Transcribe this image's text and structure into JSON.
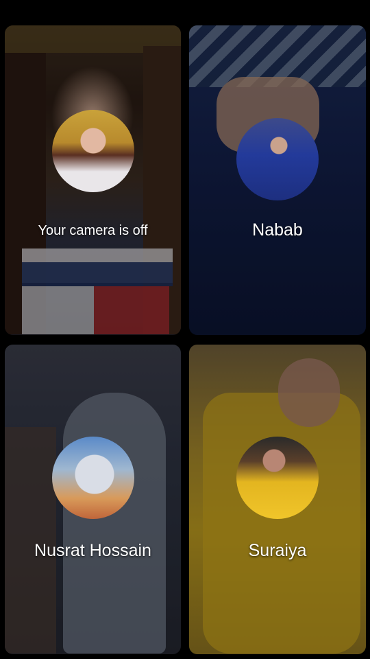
{
  "participants": [
    {
      "label": "Your camera is off",
      "avatar_icon": "user-avatar-icon",
      "tile_tone": "#3b2c22"
    },
    {
      "label": "Nabab",
      "avatar_icon": "user-avatar-icon",
      "tile_tone": "#13204a"
    },
    {
      "label": "Nusrat Hossain",
      "avatar_icon": "user-avatar-icon",
      "tile_tone": "#2e3342"
    },
    {
      "label": "Suraiya",
      "avatar_icon": "user-avatar-icon",
      "tile_tone": "#b9981f"
    }
  ],
  "colors": {
    "background": "#000000",
    "label_text": "#ffffff"
  }
}
